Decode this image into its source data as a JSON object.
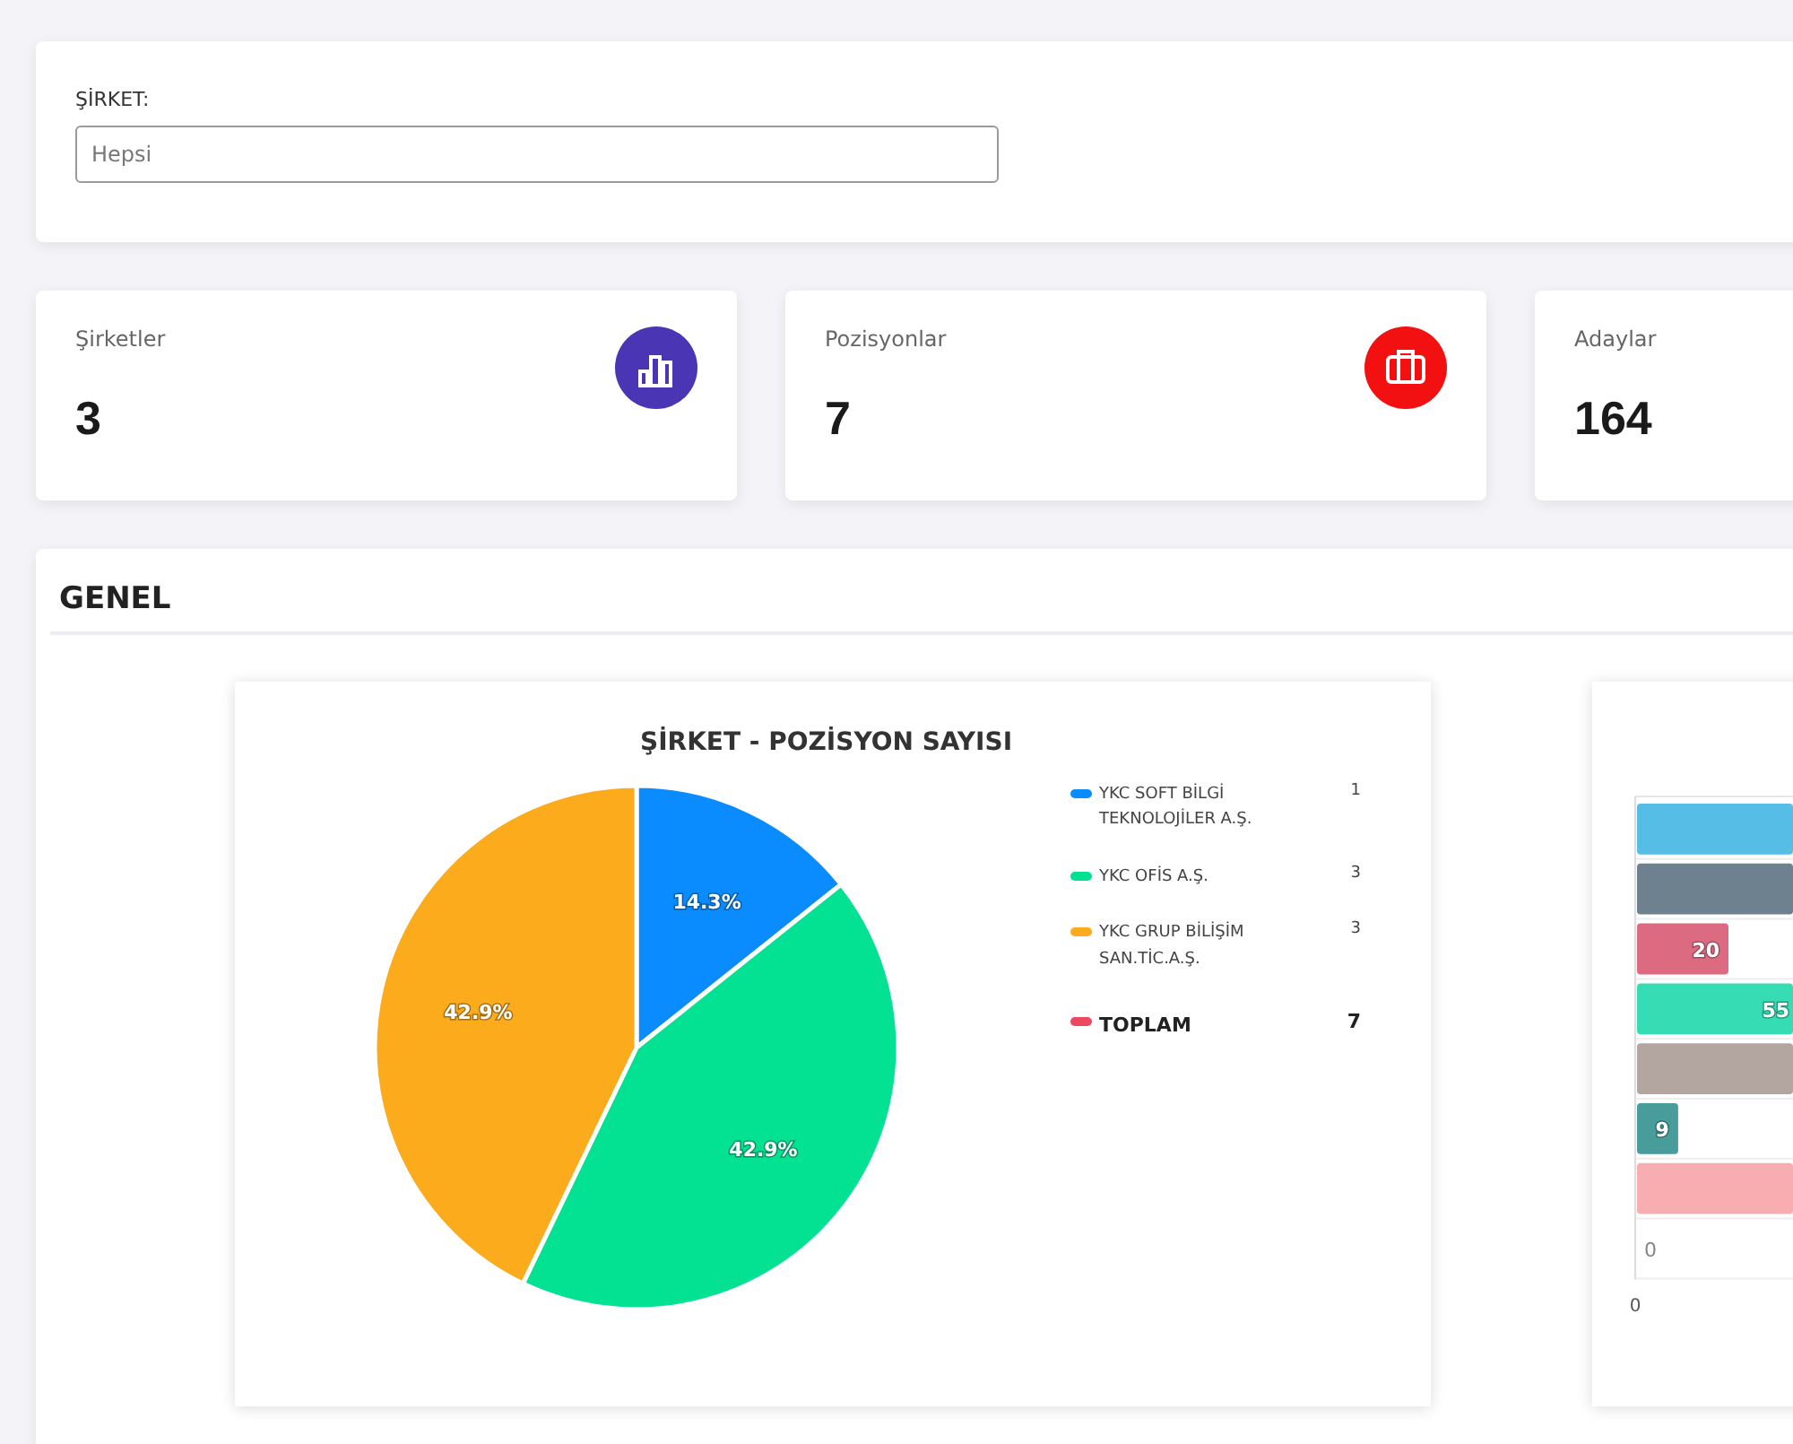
{
  "filter": {
    "label": "ŞİRKET:",
    "placeholder": "Hepsi"
  },
  "stats": [
    {
      "label": "Şirketler",
      "value": "3",
      "color": "#4a35b5"
    },
    {
      "label": "Pozisyonlar",
      "value": "7",
      "color": "#f21010"
    },
    {
      "label": "Adaylar",
      "value": "164"
    }
  ],
  "panel": {
    "title": "GENEL",
    "pie_card": {
      "legend": [
        {
          "name": "YKC SOFT BİLGİ TEKNOLOJİLER A.Ş.",
          "count": "1",
          "color": "#0a8cff",
          "kind": "item"
        },
        {
          "name": "YKC OFİS A.Ş.",
          "count": "3",
          "color": "#03e192",
          "kind": "item"
        },
        {
          "name": "YKC GRUP BİLİŞİM SAN.TİC.A.Ş.",
          "count": "3",
          "color": "#fbab1c",
          "kind": "item"
        },
        {
          "name": "TOPLAM",
          "count": "7",
          "color": "#ee4762",
          "kind": "total"
        }
      ],
      "chart_data": {
        "type": "pie",
        "title": "ŞİRKET - POZİSYON SAYISI",
        "values": [
          14.3,
          42.9,
          42.9
        ],
        "colors": [
          "#0a8cff",
          "#03e192",
          "#fbab1c"
        ],
        "value_labels": [
          "14.3%",
          "42.9%",
          "42.9%"
        ]
      }
    },
    "bar_card": {
      "x_axis_label": "0",
      "bars": [
        {
          "color": "#55bde6"
        },
        {
          "color": "#6e818e"
        },
        {
          "color": "#dc6b81",
          "label": "20"
        },
        {
          "color": "#35dcb4",
          "label": "55"
        },
        {
          "color": "#b3a59f"
        },
        {
          "color": "#489c9a",
          "label": "9"
        },
        {
          "color": "#f8aeb0"
        },
        {
          "label": "0"
        }
      ]
    }
  }
}
